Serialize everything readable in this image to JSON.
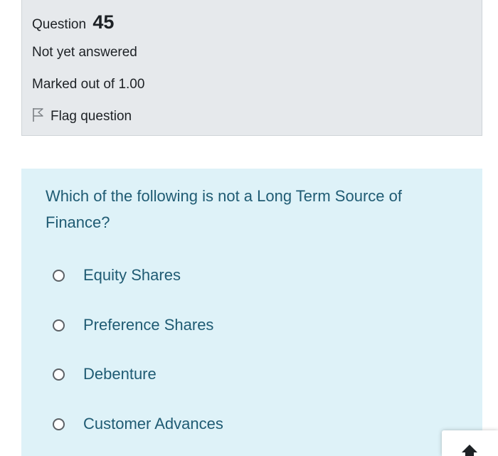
{
  "question": {
    "label": "Question",
    "number": "45",
    "status": "Not yet answered",
    "marks": "Marked out of 1.00",
    "flag_label": "Flag question",
    "text": "Which of the following is not a Long Term Source of Finance?",
    "options": [
      {
        "label": "Equity Shares"
      },
      {
        "label": "Preference Shares"
      },
      {
        "label": "Debenture"
      },
      {
        "label": "Customer Advances"
      }
    ]
  },
  "icons": {
    "flag": "flag-icon",
    "radio": "radio-unchecked-icon",
    "back_to_top": "arrow-up-icon"
  },
  "colors": {
    "info_background": "#e6e9ec",
    "question_background": "#def2f8",
    "question_text": "#1f5b73"
  }
}
